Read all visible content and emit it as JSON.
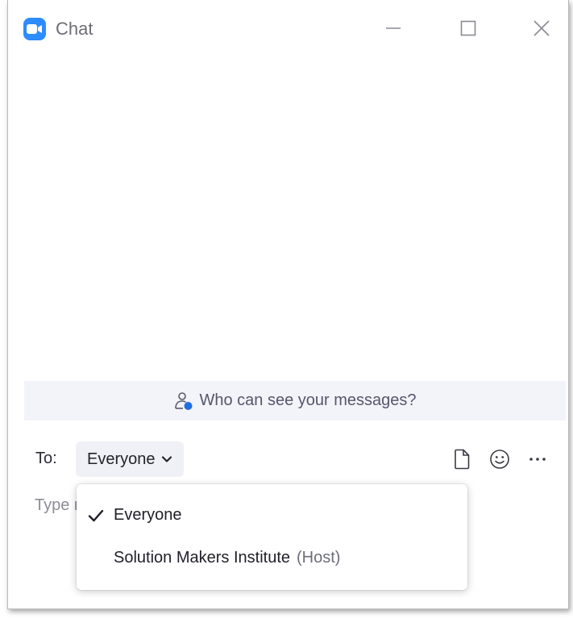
{
  "window": {
    "title": "Chat",
    "controls": [
      "minimize-icon",
      "maximize-icon",
      "close-icon"
    ]
  },
  "colors": {
    "accent": "#2d8cff",
    "banner_bg": "#f3f4fa",
    "text_muted": "#6e6e78"
  },
  "banner": {
    "icon": "participant-lock-icon",
    "text": "Who can see your messages?"
  },
  "composer": {
    "to_label": "To:",
    "recipient": "Everyone",
    "placeholder": "Type message here ...",
    "tools": [
      "file-icon",
      "emoji-icon",
      "more-icon"
    ]
  },
  "recipient_menu": {
    "items": [
      {
        "label": "Everyone",
        "selected": true,
        "tag": ""
      },
      {
        "label": "Solution Makers Institute",
        "selected": false,
        "tag": "(Host)"
      }
    ]
  }
}
